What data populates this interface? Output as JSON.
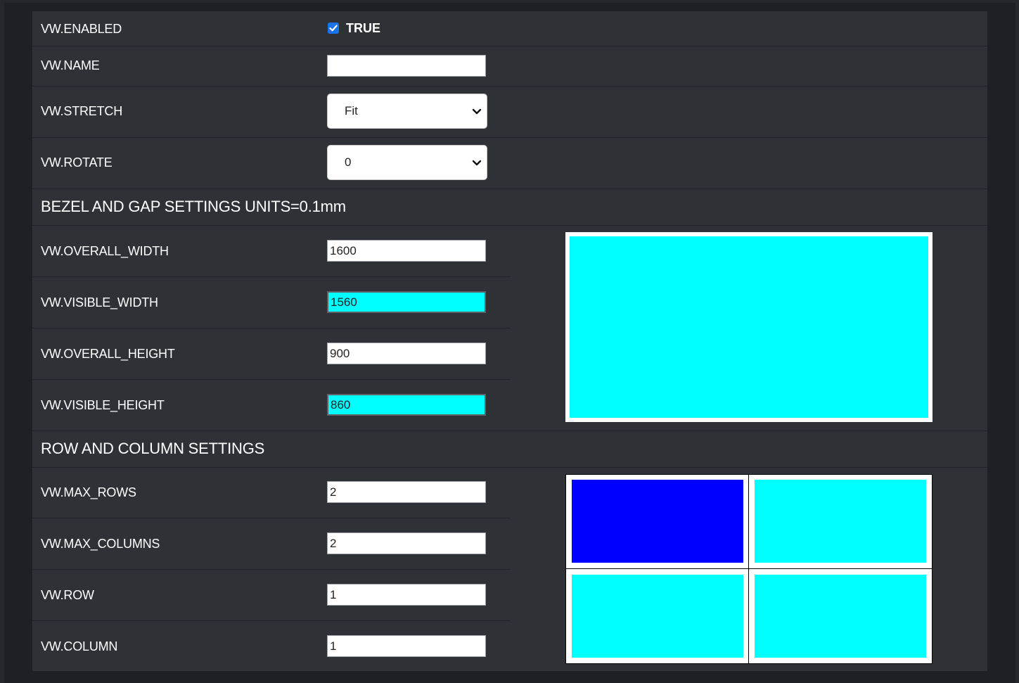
{
  "colors": {
    "panel_bg": "#2e3237",
    "visible_highlight": "#00ffff",
    "tile_selected": "#0000ff",
    "tile_default": "#00ffff"
  },
  "enabled": {
    "label": "VW.ENABLED",
    "value_label": "TRUE",
    "checked": true
  },
  "name": {
    "label": "VW.NAME",
    "value": ""
  },
  "stretch": {
    "label": "VW.STRETCH",
    "selected": "Fit",
    "icon": "chevron-down-icon"
  },
  "rotate": {
    "label": "VW.ROTATE",
    "selected": "0",
    "icon": "chevron-down-icon"
  },
  "bezel_section": {
    "title": "BEZEL AND GAP SETTINGS UNITS=0.1mm",
    "overall_width": {
      "label": "VW.OVERALL_WIDTH",
      "value": "1600"
    },
    "visible_width": {
      "label": "VW.VISIBLE_WIDTH",
      "value": "1560"
    },
    "overall_height": {
      "label": "VW.OVERALL_HEIGHT",
      "value": "900"
    },
    "visible_height": {
      "label": "VW.VISIBLE_HEIGHT",
      "value": "860"
    }
  },
  "rowcol_section": {
    "title": "ROW AND COLUMN SETTINGS",
    "max_rows": {
      "label": "VW.MAX_ROWS",
      "value": "2"
    },
    "max_columns": {
      "label": "VW.MAX_COLUMNS",
      "value": "2"
    },
    "row": {
      "label": "VW.ROW",
      "value": "1"
    },
    "column": {
      "label": "VW.COLUMN",
      "value": "1"
    }
  },
  "grid_preview": {
    "rows": 2,
    "columns": 2,
    "selected_row": 1,
    "selected_column": 1
  }
}
